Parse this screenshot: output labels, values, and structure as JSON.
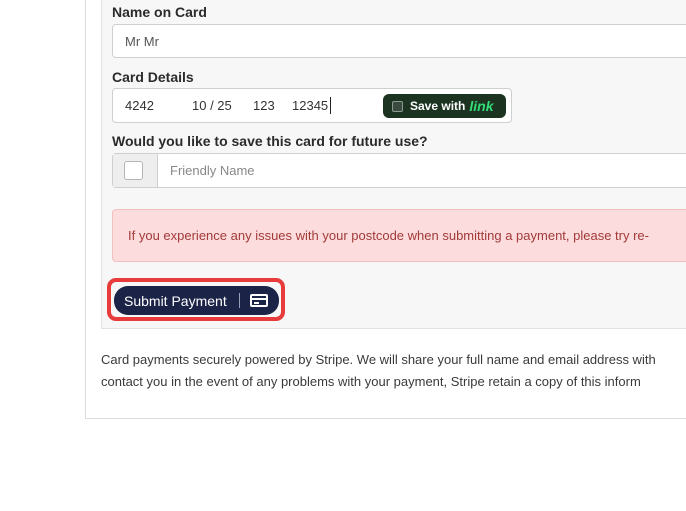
{
  "form": {
    "name_label": "Name on Card",
    "name_value": "Mr Mr",
    "card_label": "Card Details",
    "card": {
      "number": "4242",
      "expiry": "10 / 25",
      "cvc": "123",
      "postcode": "12345",
      "link_save_text": "Save with",
      "link_brand": "link"
    },
    "save_label": "Would you like to save this card for future use?",
    "friendly_placeholder": "Friendly Name",
    "alert_text": "If you experience any issues with your postcode when submitting a payment, please try re-",
    "submit_label": "Submit Payment"
  },
  "disclaimer": {
    "line1": "Card payments securely powered by Stripe. We will share your full name and email address with",
    "line2": "contact you in the event of any problems with your payment, Stripe retain a copy of this inform"
  },
  "colors": {
    "submit_bg": "#1b2346",
    "highlight": "#e83c3c",
    "alert_bg": "#fcdcdc",
    "alert_text": "#a33a3a",
    "link_pill_bg": "#1c3322",
    "link_brand": "#33dd77"
  },
  "icons": {
    "submit": "credit-card-icon"
  }
}
